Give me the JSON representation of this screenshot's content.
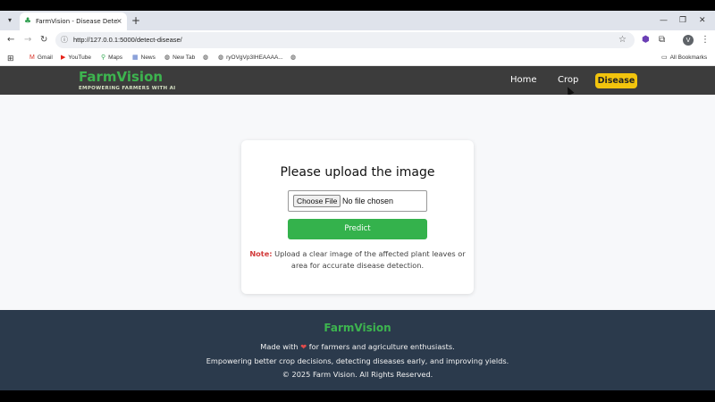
{
  "browser": {
    "tab_title": "FarmVision - Disease Detection",
    "tab_close": "×",
    "new_tab": "+",
    "url": "http://127.0.0.1:5000/detect-disease/",
    "bookmarks": [
      {
        "label": "Gmail",
        "icon": "M"
      },
      {
        "label": "YouTube",
        "icon": "▶"
      },
      {
        "label": "Maps",
        "icon": "⚲"
      },
      {
        "label": "News",
        "icon": "▦"
      },
      {
        "label": "New Tab",
        "icon": "◍"
      },
      {
        "label": "",
        "icon": "◍"
      },
      {
        "label": "ryOVgVp3IHEAAAA...",
        "icon": "◍"
      },
      {
        "label": "",
        "icon": "◍"
      }
    ],
    "all_bookmarks": "All Bookmarks",
    "avatar_letter": "V",
    "extension_badge": "2"
  },
  "site": {
    "brand": "FarmVision",
    "tagline": "EMPOWERING FARMERS WITH AI",
    "nav": {
      "home": "Home",
      "crop": "Crop",
      "disease": "Disease"
    },
    "accent_color": "#3db44f",
    "active_nav_color": "#f2c40d"
  },
  "upload": {
    "title": "Please upload the image",
    "choose_file": "Choose File",
    "no_file": "No file chosen",
    "predict": "Predict",
    "note_label": "Note:",
    "note_text": "Upload a clear image of the affected plant leaves or area for accurate disease detection."
  },
  "footer": {
    "brand": "FarmVision",
    "made_with_prefix": "Made with",
    "heart": "❤",
    "made_with_suffix": "for farmers and agriculture enthusiasts.",
    "line2": "Empowering better crop decisions, detecting diseases early, and improving yields.",
    "copyright": "© 2025 Farm Vision. All Rights Reserved."
  }
}
